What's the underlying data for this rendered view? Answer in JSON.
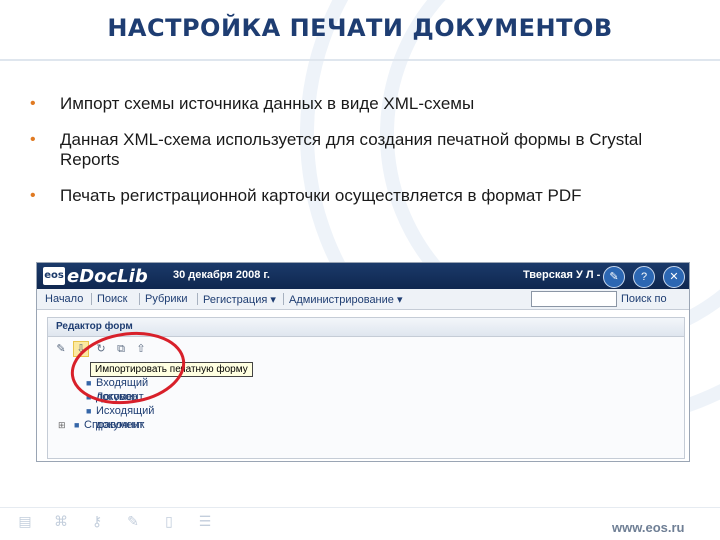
{
  "slide": {
    "title": "НАСТРОЙКА ПЕЧАТИ ДОКУМЕНТОВ",
    "bullets": [
      "Импорт схемы источника данных в виде XML-схемы",
      "Данная XML-схема используется для создания печатной формы в Crystal Reports",
      "Печать регистрационной карточки осуществляется в формат PDF"
    ],
    "bullet_marker": "•",
    "footer_url": "www.eos.ru",
    "footer_icons": [
      "book-icon",
      "network-icon",
      "key-icon",
      "pen-icon",
      "document-icon",
      "list-icon"
    ]
  },
  "app": {
    "logo_mark": "eos",
    "logo_text": "eDocLib",
    "date": "30 декабря 2008 г.",
    "user": "Тверская У Л -",
    "menu": [
      "Начало",
      "Поиск",
      "Рубрики",
      "Регистрация ▾",
      "Администрирование ▾"
    ],
    "search_button": "Поиск по",
    "panel_title": "Редактор форм",
    "tooltip": "Импортировать печатную форму",
    "tree": [
      {
        "label": "Входящий документ"
      },
      {
        "label": "Договор"
      },
      {
        "label": "Исходящий документ"
      },
      {
        "label": "Справочник"
      }
    ]
  },
  "colors": {
    "title": "#1e3d72",
    "bullet": "#e07a22",
    "app_header": "#1b3a6a",
    "highlight_circle": "#d8202a"
  }
}
